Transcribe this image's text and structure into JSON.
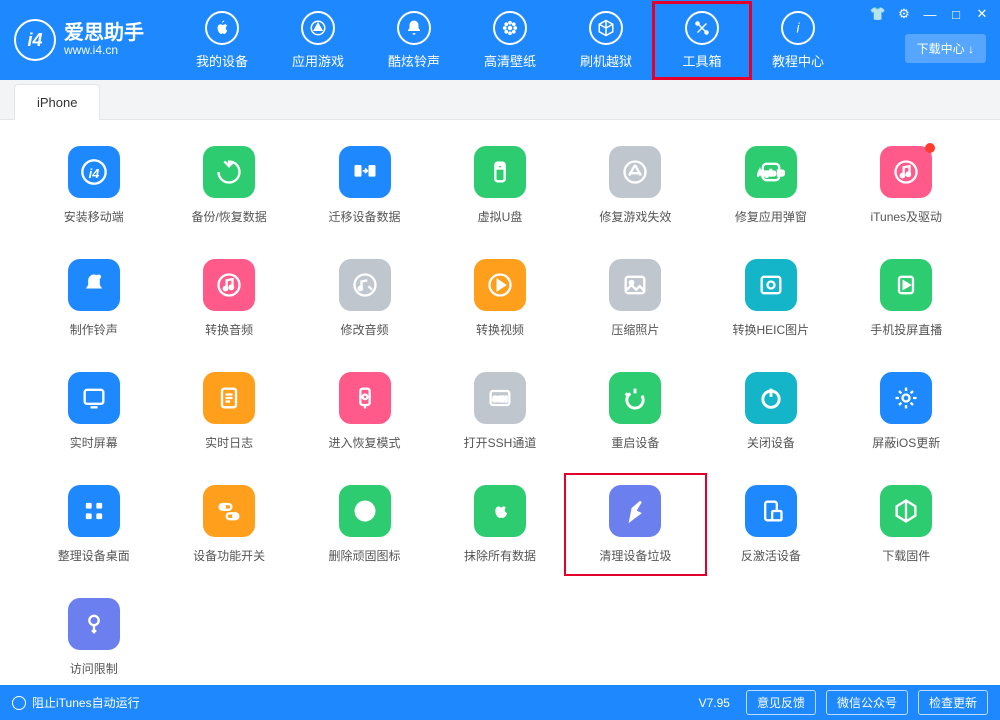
{
  "app": {
    "name": "爱思助手",
    "url": "www.i4.cn",
    "logo_text": "i4"
  },
  "win": {
    "download_center": "下载中心 ↓"
  },
  "nav": [
    {
      "id": "device",
      "label": "我的设备",
      "icon": "apple"
    },
    {
      "id": "apps",
      "label": "应用游戏",
      "icon": "store"
    },
    {
      "id": "ringtone",
      "label": "酷炫铃声",
      "icon": "bell"
    },
    {
      "id": "wallpaper",
      "label": "高清壁纸",
      "icon": "flower"
    },
    {
      "id": "flash",
      "label": "刷机越狱",
      "icon": "box"
    },
    {
      "id": "toolbox",
      "label": "工具箱",
      "icon": "tools",
      "selected": true
    },
    {
      "id": "tutorial",
      "label": "教程中心",
      "icon": "info"
    }
  ],
  "tab": {
    "active": "iPhone"
  },
  "tools": [
    {
      "label": "安装移动端",
      "color": "#1E88FE",
      "icon": "i4",
      "name": "tool-install-mobile"
    },
    {
      "label": "备份/恢复数据",
      "color": "#2ECC71",
      "icon": "restore",
      "name": "tool-backup-restore"
    },
    {
      "label": "迁移设备数据",
      "color": "#1E88FE",
      "icon": "migrate",
      "name": "tool-migrate"
    },
    {
      "label": "虚拟U盘",
      "color": "#2ECC71",
      "icon": "usb",
      "name": "tool-virtual-usb"
    },
    {
      "label": "修复游戏失效",
      "color": "#BFC6CD",
      "icon": "appstore",
      "name": "tool-fix-game"
    },
    {
      "label": "修复应用弹窗",
      "color": "#2ECC71",
      "icon": "appleid",
      "name": "tool-fix-popup"
    },
    {
      "label": "iTunes及驱动",
      "color": "#FF5A8A",
      "icon": "itunes",
      "name": "tool-itunes-driver",
      "badge": true
    },
    {
      "label": "制作铃声",
      "color": "#1E88FE",
      "icon": "bell2",
      "name": "tool-make-ringtone"
    },
    {
      "label": "转换音频",
      "color": "#FF5A8A",
      "icon": "audio",
      "name": "tool-convert-audio"
    },
    {
      "label": "修改音频",
      "color": "#BFC6CD",
      "icon": "audioedit",
      "name": "tool-edit-audio"
    },
    {
      "label": "转换视频",
      "color": "#FF9F1C",
      "icon": "play",
      "name": "tool-convert-video"
    },
    {
      "label": "压缩照片",
      "color": "#BFC6CD",
      "icon": "image",
      "name": "tool-compress-photo"
    },
    {
      "label": "转换HEIC图片",
      "color": "#14B5C9",
      "icon": "heic",
      "name": "tool-convert-heic"
    },
    {
      "label": "手机投屏直播",
      "color": "#2ECC71",
      "icon": "cast",
      "name": "tool-screen-cast"
    },
    {
      "label": "实时屏幕",
      "color": "#1E88FE",
      "icon": "screen",
      "name": "tool-realtime-screen"
    },
    {
      "label": "实时日志",
      "color": "#FF9F1C",
      "icon": "log",
      "name": "tool-realtime-log"
    },
    {
      "label": "进入恢复模式",
      "color": "#FF5A8A",
      "icon": "recovery",
      "name": "tool-recovery-mode"
    },
    {
      "label": "打开SSH通道",
      "color": "#BFC6CD",
      "icon": "ssh",
      "name": "tool-ssh"
    },
    {
      "label": "重启设备",
      "color": "#2ECC71",
      "icon": "restart",
      "name": "tool-restart"
    },
    {
      "label": "关闭设备",
      "color": "#14B5C9",
      "icon": "power",
      "name": "tool-shutdown"
    },
    {
      "label": "屏蔽iOS更新",
      "color": "#1E88FE",
      "icon": "gear",
      "name": "tool-block-update"
    },
    {
      "label": "整理设备桌面",
      "color": "#1E88FE",
      "icon": "grid",
      "name": "tool-organize-home"
    },
    {
      "label": "设备功能开关",
      "color": "#FF9F1C",
      "icon": "toggles",
      "name": "tool-feature-switch"
    },
    {
      "label": "删除顽固图标",
      "color": "#2ECC71",
      "icon": "pie",
      "name": "tool-delete-icon"
    },
    {
      "label": "抹除所有数据",
      "color": "#2ECC71",
      "icon": "apple2",
      "name": "tool-erase-all"
    },
    {
      "label": "清理设备垃圾",
      "color": "#6C7FEE",
      "icon": "clean",
      "name": "tool-clean-junk",
      "highlighted": true
    },
    {
      "label": "反激活设备",
      "color": "#1E88FE",
      "icon": "deactivate",
      "name": "tool-deactivate"
    },
    {
      "label": "下载固件",
      "color": "#2ECC71",
      "icon": "firmware",
      "name": "tool-download-firmware"
    },
    {
      "label": "访问限制",
      "color": "#6C7FEE",
      "icon": "key",
      "name": "tool-access-limit"
    }
  ],
  "footer": {
    "stop_itunes": "阻止iTunes自动运行",
    "version": "V7.95",
    "feedback": "意见反馈",
    "wechat": "微信公众号",
    "check_update": "检查更新"
  }
}
